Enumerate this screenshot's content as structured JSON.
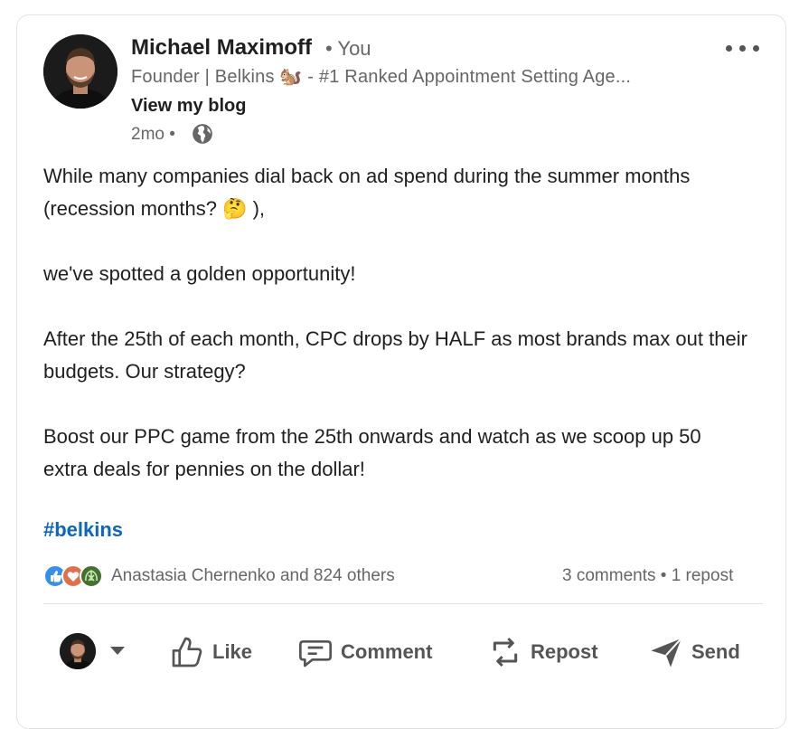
{
  "post": {
    "author": {
      "name": "Michael Maximoff",
      "relation": "• You",
      "headline": "Founder | Belkins 🐿️ - #1 Ranked Appointment Setting Age...",
      "blog_link": "View my blog",
      "time": "2mo •"
    },
    "paragraphs": [
      "While many companies dial back on ad spend during the summer months (recession months? 🤔 ),",
      "we've spotted a golden opportunity!",
      "After the 25th of each month, CPC drops by HALF as most brands max out their budgets. Our strategy?",
      "Boost our PPC game from the 25th onwards and watch as we scoop up 50 extra deals for pennies on the dollar!"
    ],
    "hashtag": "#belkins",
    "social": {
      "reaction_names": "Anastasia Chernenko and 824 others",
      "counts": "3 comments • 1 repost"
    },
    "actions": {
      "like": "Like",
      "comment": "Comment",
      "repost": "Repost",
      "send": "Send"
    }
  },
  "icons": {
    "more": "more-horizontal-icon",
    "globe": "globe-icon",
    "like": "thumbs-up-icon",
    "comment": "comment-bubble-icon",
    "repost": "repost-arrows-icon",
    "send": "paper-plane-icon",
    "reactions": [
      "like-reaction-icon",
      "love-reaction-icon",
      "insightful-reaction-icon"
    ]
  },
  "colors": {
    "link_blue": "#0a66c2",
    "secondary_text": "#666666",
    "like_blue": "#378fe9",
    "love_red": "#df704d",
    "insightful_green": "#44712e"
  }
}
